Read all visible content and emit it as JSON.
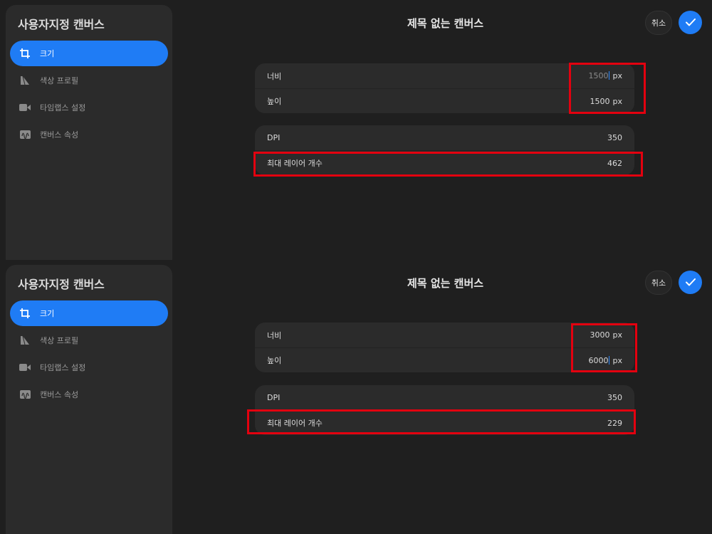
{
  "panels": [
    {
      "sidebar": {
        "title": "사용자지정 캔버스",
        "items": [
          {
            "label": "크기",
            "icon": "crop-icon",
            "active": true
          },
          {
            "label": "색상 프로필",
            "icon": "color-profile-icon",
            "active": false
          },
          {
            "label": "타임랩스 설정",
            "icon": "video-camera-icon",
            "active": false
          },
          {
            "label": "캔버스 속성",
            "icon": "canvas-properties-icon",
            "active": false
          }
        ]
      },
      "header": {
        "title": "제목 없는 캔버스",
        "cancel_label": "취소"
      },
      "size": {
        "width_label": "너비",
        "width_value": "1500",
        "width_unit": "px",
        "height_label": "높이",
        "height_value": "1500",
        "height_unit": "px"
      },
      "properties": {
        "dpi_label": "DPI",
        "dpi_value": "350",
        "layers_label": "최대 레이어 개수",
        "layers_value": "462"
      }
    },
    {
      "sidebar": {
        "title": "사용자지정 캔버스",
        "items": [
          {
            "label": "크기",
            "icon": "crop-icon",
            "active": true
          },
          {
            "label": "색상 프로필",
            "icon": "color-profile-icon",
            "active": false
          },
          {
            "label": "타임랩스 설정",
            "icon": "video-camera-icon",
            "active": false
          },
          {
            "label": "캔버스 속성",
            "icon": "canvas-properties-icon",
            "active": false
          }
        ]
      },
      "header": {
        "title": "제목 없는 캔버스",
        "cancel_label": "취소"
      },
      "size": {
        "width_label": "너비",
        "width_value": "3000",
        "width_unit": "px",
        "height_label": "높이",
        "height_value": "6000",
        "height_unit": "px"
      },
      "properties": {
        "dpi_label": "DPI",
        "dpi_value": "350",
        "layers_label": "최대 레이어 개수",
        "layers_value": "229"
      }
    }
  ],
  "colors": {
    "accent": "#1f7cf5",
    "highlight": "#e3000f",
    "background": "#1f1f1f",
    "surface": "#2b2b2b"
  }
}
